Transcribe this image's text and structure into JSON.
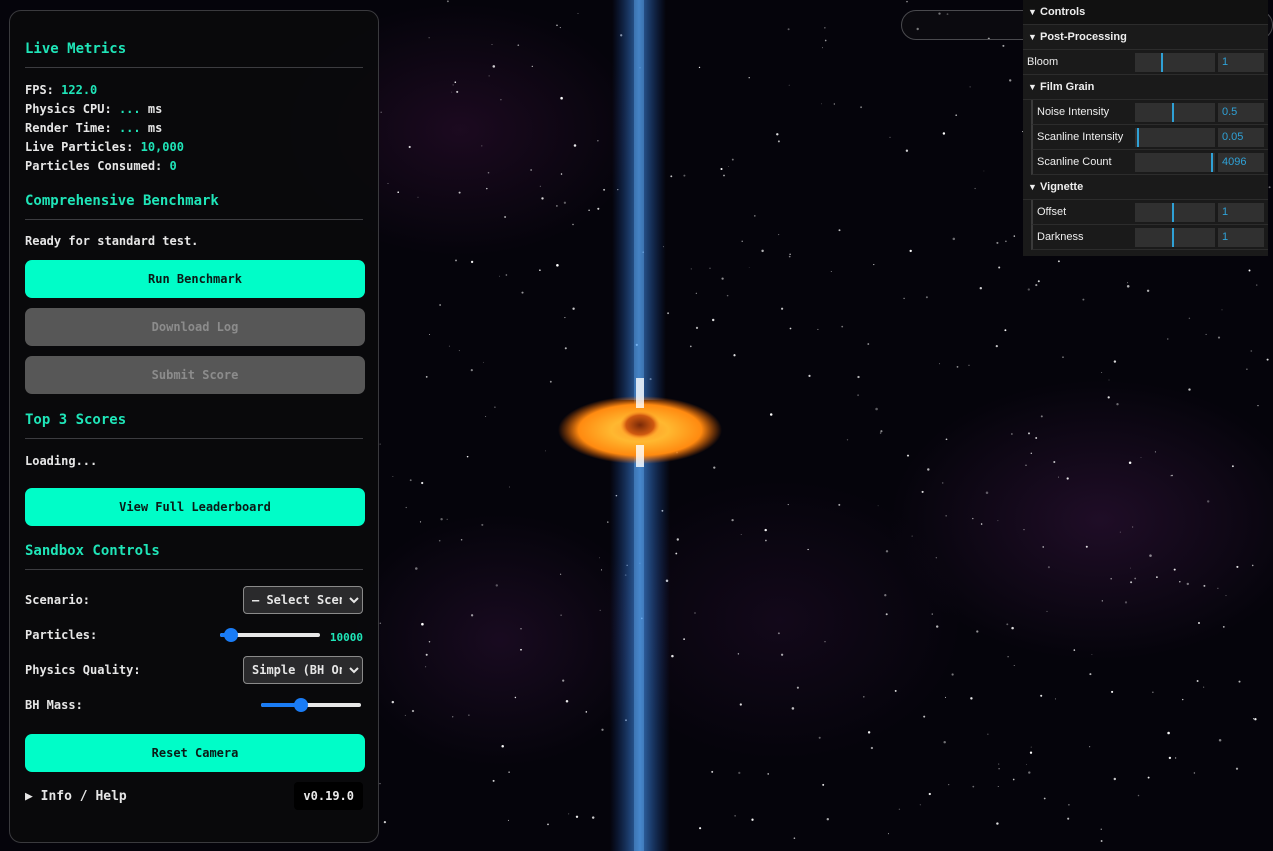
{
  "colors": {
    "accent": "#00fdc8",
    "slider": "#1a7cf5",
    "gui_number": "#2fa1d6"
  },
  "live_metrics": {
    "title": "Live Metrics",
    "fps_label": "FPS:",
    "fps_value": "122.0",
    "physics_label": "Physics CPU:",
    "physics_value": "...",
    "physics_unit": "ms",
    "render_label": "Render Time:",
    "render_value": "...",
    "render_unit": "ms",
    "particles_label": "Live Particles:",
    "particles_value": "10,000",
    "consumed_label": "Particles Consumed:",
    "consumed_value": "0"
  },
  "benchmark": {
    "title": "Comprehensive Benchmark",
    "status": "Ready for standard test.",
    "run_label": "Run Benchmark",
    "download_label": "Download Log",
    "submit_label": "Submit Score"
  },
  "scores": {
    "title": "Top 3 Scores",
    "status": "Loading...",
    "leaderboard_label": "View Full Leaderboard"
  },
  "sandbox": {
    "title": "Sandbox Controls",
    "scenario_label": "Scenario:",
    "scenario_value": "– Select Scenario –",
    "particles_label": "Particles:",
    "particles_value": "10000",
    "particles_level": 0.05,
    "quality_label": "Physics Quality:",
    "quality_value": "Simple (BH Only)",
    "mass_label": "BH Mass:",
    "mass_level": 0.38,
    "reset_label": "Reset Camera"
  },
  "footer": {
    "help_label": "▶ Info / Help",
    "version": "v0.19.0"
  },
  "gui": {
    "title": "Controls",
    "post_folder": "Post-Processing",
    "bloom": {
      "label": "Bloom",
      "value": "1",
      "level": 0.33
    },
    "grain_folder": "Film Grain",
    "noise": {
      "label": "Noise Intensity",
      "value": "0.5",
      "level": 0.48
    },
    "scan_intensity": {
      "label": "Scanline Intensity",
      "value": "0.05",
      "level": 0.03
    },
    "scan_count": {
      "label": "Scanline Count",
      "value": "4096",
      "level": 0.97
    },
    "vignette_folder": "Vignette",
    "offset": {
      "label": "Offset",
      "value": "1",
      "level": 0.48
    },
    "darkness": {
      "label": "Darkness",
      "value": "1",
      "level": 0.48
    }
  }
}
